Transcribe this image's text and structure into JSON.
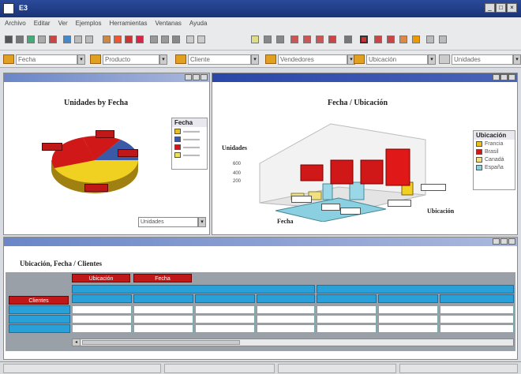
{
  "window": {
    "title": "E3",
    "min": "_",
    "max": "□",
    "close": "×"
  },
  "menu": [
    "Archivo",
    "Editar",
    "Ver",
    "Ejemplos",
    "Herramientas",
    "Ventanas",
    "Ayuda"
  ],
  "filters": [
    {
      "value": "Fecha"
    },
    {
      "value": "Producto"
    },
    {
      "value": "Cliente"
    },
    {
      "value": "Vendedores"
    },
    {
      "value": "Ubicación"
    },
    {
      "value": "Unidades"
    }
  ],
  "pie_panel": {
    "title": "Unidades by Fecha",
    "legend_title": "Fecha",
    "dropdown": "Unidades",
    "colors": [
      "#e8c020",
      "#3a5aa8",
      "#d01818",
      "#f0e060"
    ]
  },
  "bar_panel": {
    "title": "Fecha / Ubicación",
    "y_axis_label": "Unidades",
    "x_axis_label": "Fecha",
    "z_axis_label": "Ubicación",
    "legend_title": "Ubicación",
    "legend_items": [
      "Francia",
      "Brasil",
      "Canadá",
      "España"
    ],
    "legend_colors": [
      "#e8c020",
      "#d01818",
      "#f0e080",
      "#8ad0e0"
    ],
    "y_ticks": [
      "600",
      "400",
      "200"
    ]
  },
  "grid_panel": {
    "title": "Ubicación, Fecha / Clientes",
    "tabs": [
      "Ubicación",
      "Fecha"
    ],
    "row_header_tab": "Clientes"
  },
  "status": {
    "segments": [
      "",
      "",
      "",
      ""
    ]
  }
}
